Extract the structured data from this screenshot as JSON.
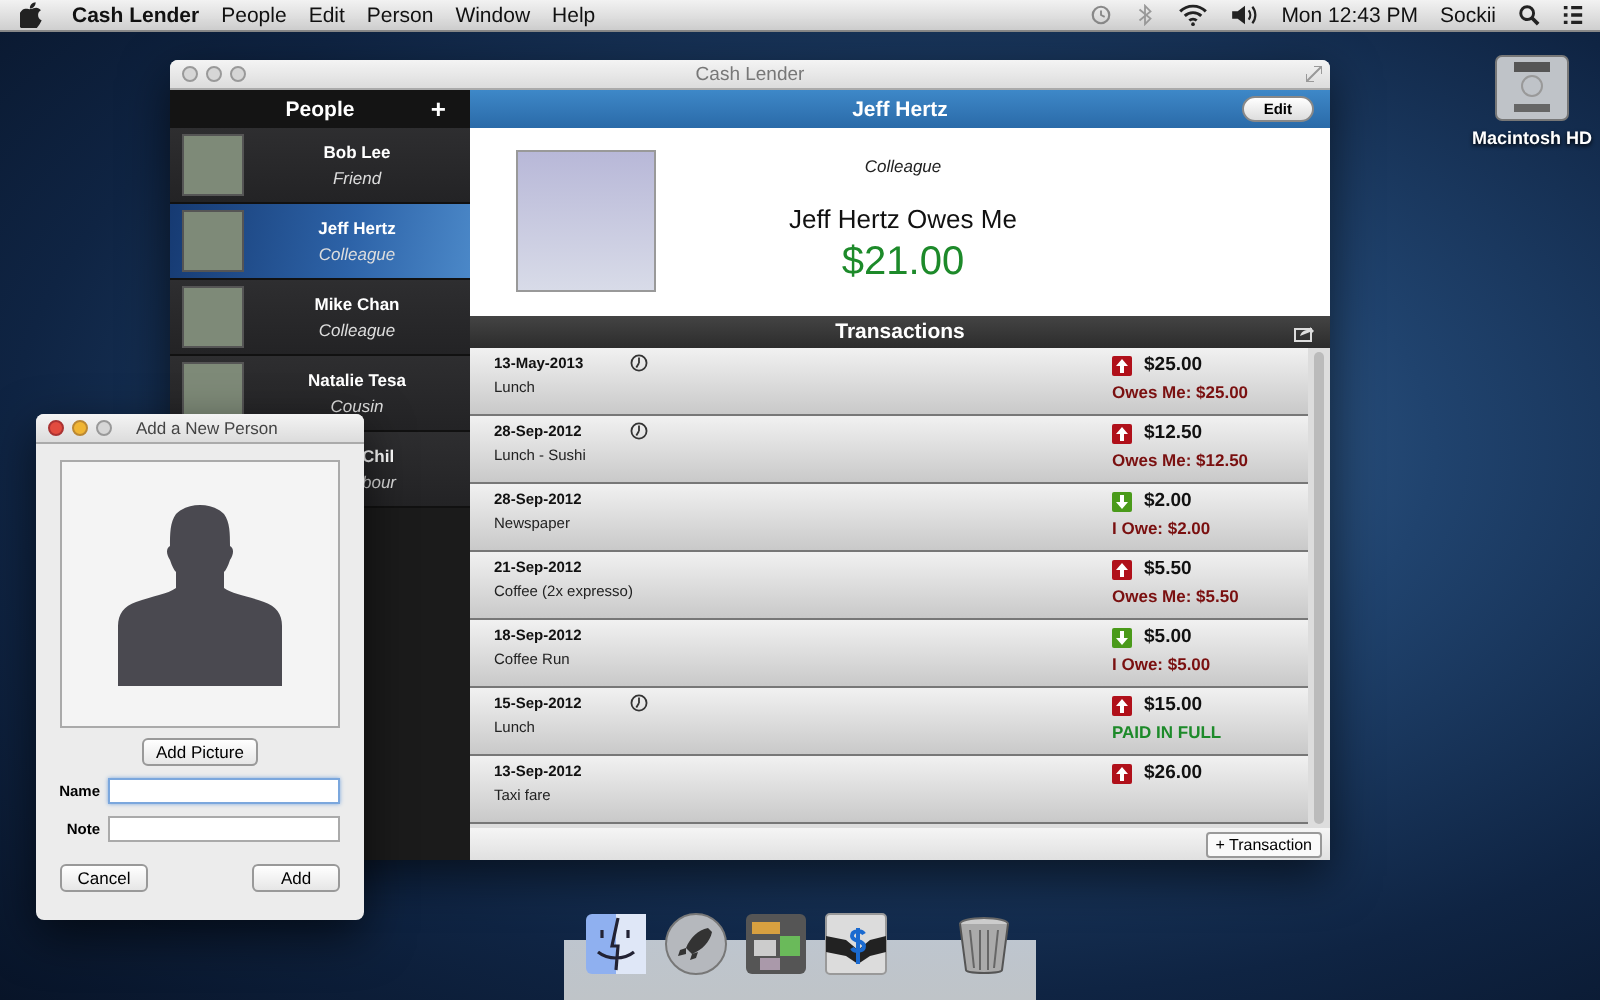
{
  "menu_bar": {
    "app_name": "Cash Lender",
    "menus": [
      "People",
      "Edit",
      "Person",
      "Window",
      "Help"
    ],
    "clock": "Mon 12:43 PM",
    "user": "Sockii"
  },
  "desktop": {
    "drive_label": "Macintosh HD"
  },
  "main_window": {
    "title": "Cash Lender",
    "sidebar": {
      "title": "People",
      "add_label": "+",
      "people": [
        {
          "name": "Bob Lee",
          "note": "Friend",
          "selected": false,
          "kind": "full"
        },
        {
          "name": "Jeff Hertz",
          "note": "Colleague",
          "selected": true,
          "kind": "full"
        },
        {
          "name": "Mike Chan",
          "note": "Colleague",
          "selected": false,
          "kind": "full"
        },
        {
          "name": "Natalie Tesa",
          "note": "Cousin",
          "selected": false,
          "kind": "full"
        },
        {
          "name": "Chil",
          "note": "bour",
          "selected": false,
          "kind": "covered"
        }
      ]
    },
    "detail": {
      "name": "Jeff Hertz",
      "edit_button": "Edit",
      "note": "Colleague",
      "summary": "Jeff Hertz Owes Me",
      "balance": "$21.00"
    },
    "transactions": {
      "title": "Transactions",
      "add_button": "+ Transaction",
      "rows": [
        {
          "date": "13-May-2013",
          "description": "Lunch",
          "reminder": true,
          "kind": "lent",
          "amount": "$25.00",
          "status": "Owes Me: $25.00",
          "paid": false
        },
        {
          "date": "28-Sep-2012",
          "description": "Lunch - Sushi",
          "reminder": true,
          "kind": "lent",
          "amount": "$12.50",
          "status": "Owes Me: $12.50",
          "paid": false
        },
        {
          "date": "28-Sep-2012",
          "description": "Newspaper",
          "reminder": false,
          "kind": "borrowed",
          "amount": "$2.00",
          "status": "I Owe: $2.00",
          "paid": false
        },
        {
          "date": "21-Sep-2012",
          "description": "Coffee (2x expresso)",
          "reminder": false,
          "kind": "lent",
          "amount": "$5.50",
          "status": "Owes Me: $5.50",
          "paid": false
        },
        {
          "date": "18-Sep-2012",
          "description": "Coffee Run",
          "reminder": false,
          "kind": "borrowed",
          "amount": "$5.00",
          "status": "I Owe: $5.00",
          "paid": false
        },
        {
          "date": "15-Sep-2012",
          "description": "Lunch",
          "reminder": true,
          "kind": "lent",
          "amount": "$15.00",
          "status": "PAID IN FULL",
          "paid": true
        },
        {
          "date": "13-Sep-2012",
          "description": "Taxi fare",
          "reminder": false,
          "kind": "lent",
          "amount": "$26.00"
        }
      ]
    }
  },
  "dialog": {
    "title": "Add a New Person",
    "add_picture_button": "Add Picture",
    "name_label": "Name",
    "name_focused": true,
    "note_label": "Note",
    "cancel_button": "Cancel",
    "add_button": "Add"
  }
}
